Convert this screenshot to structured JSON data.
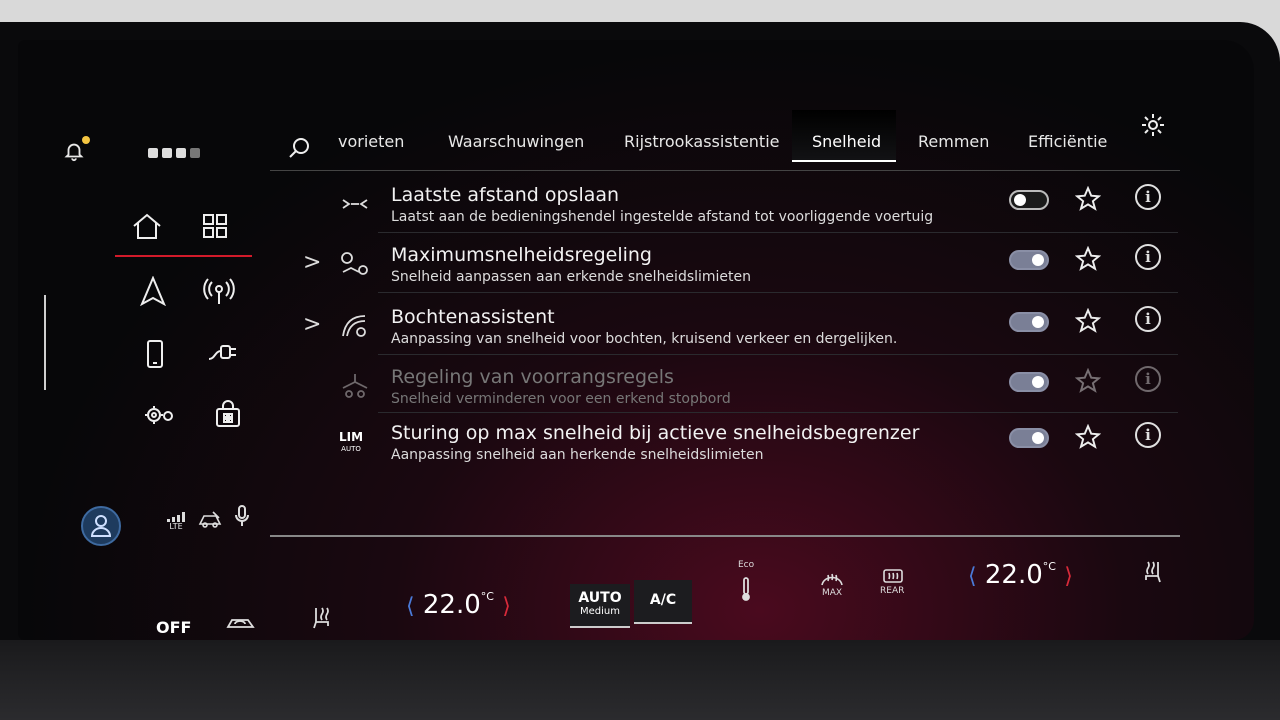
{
  "tabs": [
    {
      "label": "vorieten"
    },
    {
      "label": "Waarschuwingen"
    },
    {
      "label": "Rijstrookassistentie"
    },
    {
      "label": "Snelheid",
      "active": true
    },
    {
      "label": "Remmen"
    },
    {
      "label": "Efficiëntie"
    }
  ],
  "rows": [
    {
      "title": "Laatste afstand opslaan",
      "subtitle": "Laatst aan de bedieningshendel ingestelde afstand tot voorliggende voertuig",
      "toggle": "off",
      "icon": "distance-icon"
    },
    {
      "title": "Maximumsnelheidsregeling",
      "subtitle": "Snelheid aanpassen aan erkende snelheidslimieten",
      "toggle": "on",
      "icon": "speed-limit-icon"
    },
    {
      "title": "Bochtenassistent",
      "subtitle": "Aanpassing van snelheid voor bochten, kruisend verkeer en dergelijken.",
      "toggle": "on",
      "icon": "curve-assist-icon"
    },
    {
      "title": "Regeling van voorrangsregels",
      "subtitle": "Snelheid verminderen voor een erkend stopbord",
      "toggle": "on",
      "disabled": true,
      "icon": "right-of-way-icon"
    },
    {
      "title": "Sturing op max snelheid bij actieve snelheidsbegrenzer",
      "subtitle": "Aanpassing snelheid aan herkende snelheidslimieten",
      "toggle": "on",
      "icon": "lim-auto-icon"
    }
  ],
  "lim_icon": {
    "top": "LIM",
    "bottom": "AUTO"
  },
  "info_glyph": "i",
  "chevron_glyph": ">",
  "status": {
    "network": "LTE"
  },
  "climate": {
    "left_temp": "22.0",
    "right_temp": "22.0",
    "unit": "°C",
    "auto_label": "AUTO",
    "auto_sub": "Medium",
    "ac_label": "A/C",
    "eco_label": "Eco",
    "max_label": "MAX",
    "rear_label": "REAR",
    "off_label": "OFF"
  },
  "colors": {
    "accent_red": "#d21a2a",
    "temp_blue": "#4a7ad8",
    "temp_red": "#d82a3a"
  }
}
